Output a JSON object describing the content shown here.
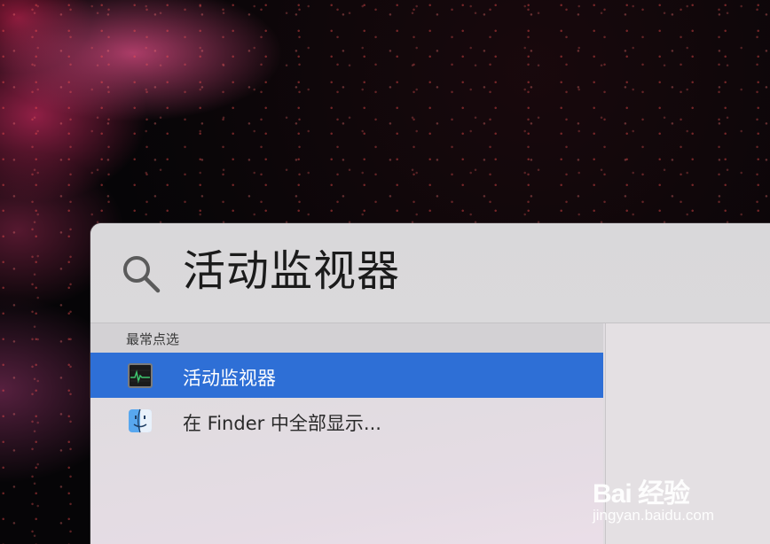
{
  "search": {
    "query": "活动监视器",
    "icon": "search-icon"
  },
  "results": {
    "section_title": "最常点选",
    "items": [
      {
        "label": "活动监视器",
        "icon": "activity-monitor-icon",
        "selected": true
      },
      {
        "label": "在 Finder 中全部显示...",
        "icon": "finder-icon",
        "selected": false
      }
    ],
    "selected_color": "#2E6FD6"
  },
  "watermark": {
    "brand": "Bai 经验",
    "url": "jingyan.baidu.com"
  }
}
